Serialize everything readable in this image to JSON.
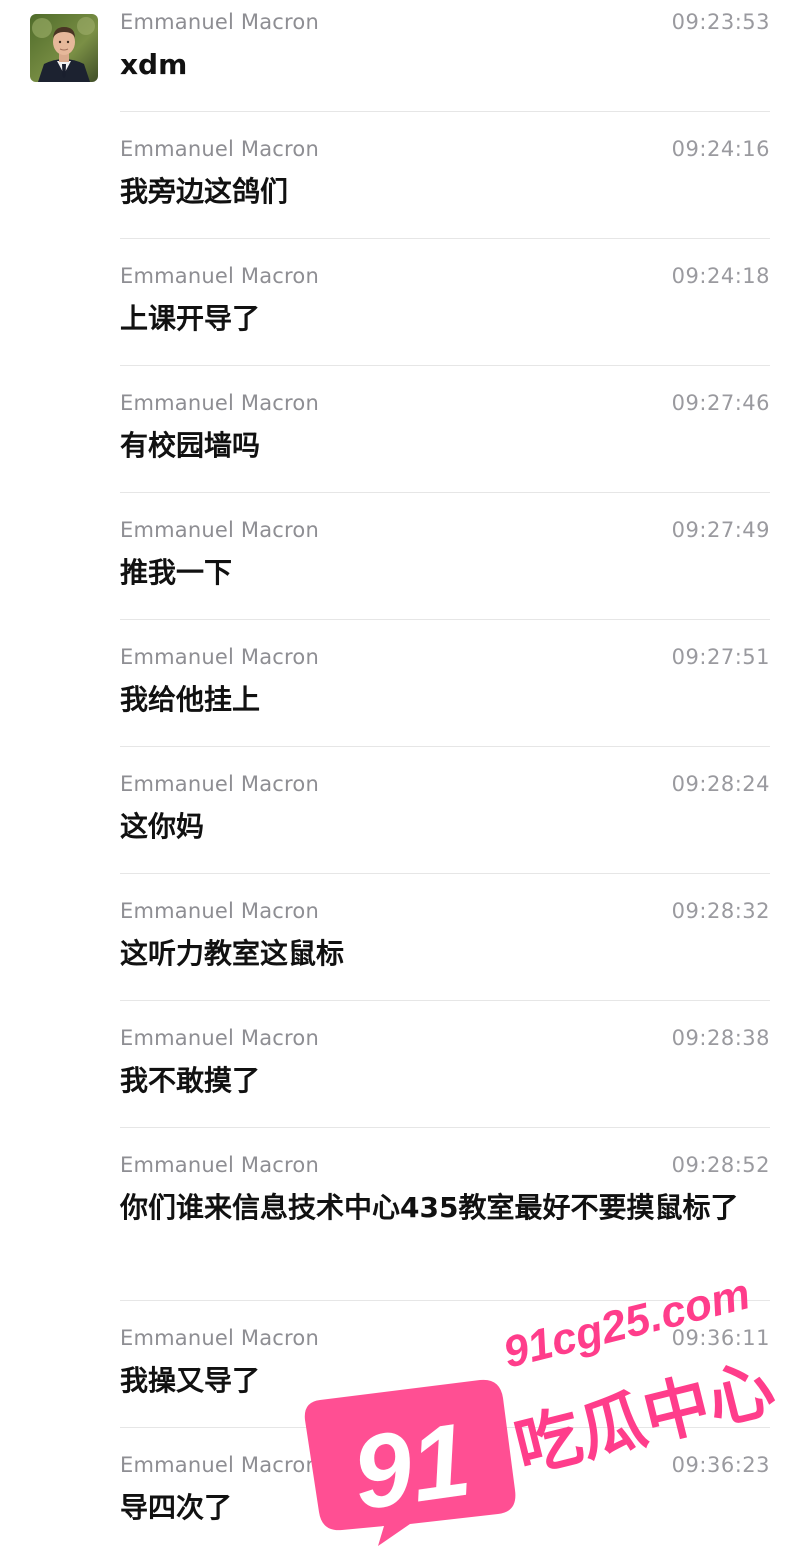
{
  "messages": [
    {
      "sender": "Emmanuel Macron",
      "time": "09:23:53",
      "text": "xdm"
    },
    {
      "sender": "Emmanuel Macron",
      "time": "09:24:16",
      "text": "我旁边这鸽们"
    },
    {
      "sender": "Emmanuel Macron",
      "time": "09:24:18",
      "text": "上课开导了"
    },
    {
      "sender": "Emmanuel Macron",
      "time": "09:27:46",
      "text": "有校园墙吗"
    },
    {
      "sender": "Emmanuel Macron",
      "time": "09:27:49",
      "text": "推我一下"
    },
    {
      "sender": "Emmanuel Macron",
      "time": "09:27:51",
      "text": "我给他挂上"
    },
    {
      "sender": "Emmanuel Macron",
      "time": "09:28:24",
      "text": "这你妈"
    },
    {
      "sender": "Emmanuel Macron",
      "time": "09:28:32",
      "text": "这听力教室这鼠标"
    },
    {
      "sender": "Emmanuel Macron",
      "time": "09:28:38",
      "text": "我不敢摸了"
    },
    {
      "sender": "Emmanuel Macron",
      "time": "09:28:52",
      "text": "你们谁来信息技术中心435教室最好不要摸鼠标了"
    },
    {
      "sender": "Emmanuel Macron",
      "time": "09:36:11",
      "text": "我操又导了"
    },
    {
      "sender": "Emmanuel Macron",
      "time": "09:36:23",
      "text": "导四次了"
    }
  ],
  "watermark": {
    "number": "91",
    "domain": "91cg25.com",
    "name": "吃瓜中心",
    "color": "#ff3d8b"
  }
}
